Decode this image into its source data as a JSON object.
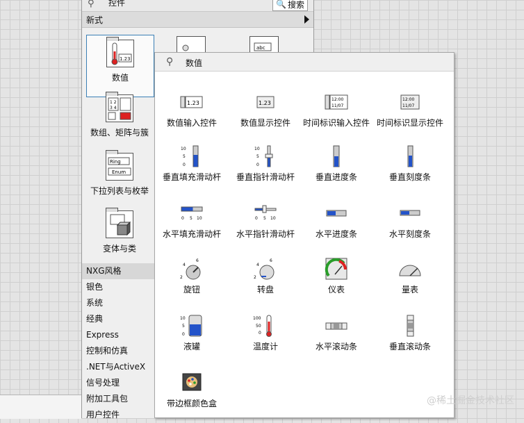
{
  "palette": {
    "title": "控件",
    "search_label": "搜索",
    "new_style_label": "新式",
    "categories": [
      "数值",
      "数组、矩阵与簇",
      "下拉列表与枚举",
      "变体与类"
    ],
    "list": [
      "NXG风格",
      "银色",
      "系统",
      "经典",
      "Express",
      "控制和仿真",
      ".NET与ActiveX",
      "信号处理",
      "附加工具包",
      "用户控件"
    ]
  },
  "numeric": {
    "title": "数值",
    "items": [
      "数值输入控件",
      "数值显示控件",
      "时间标识输入控件",
      "时间标识显示控件",
      "垂直填充滑动杆",
      "垂直指针滑动杆",
      "垂直进度条",
      "垂直刻度条",
      "水平填充滑动杆",
      "水平指针滑动杆",
      "水平进度条",
      "水平刻度条",
      "旋钮",
      "转盘",
      "仪表",
      "量表",
      "液罐",
      "温度计",
      "水平滚动条",
      "垂直滚动条",
      "带边框颜色盒"
    ]
  },
  "icon_text": {
    "num_value": "1.23",
    "abc": "abc",
    "time_top": "12:00",
    "time_bottom": "11/07",
    "ring": "Ring",
    "enum": "Enum",
    "ticks_vertical": [
      "10",
      "5",
      "0"
    ],
    "ticks_horizontal": [
      "0",
      "5",
      "10"
    ],
    "knob_ticks": [
      "4",
      "6",
      "2"
    ],
    "thermo_ticks": [
      "100",
      "50",
      "0"
    ]
  },
  "watermark": "@稀土掘金技术社区"
}
